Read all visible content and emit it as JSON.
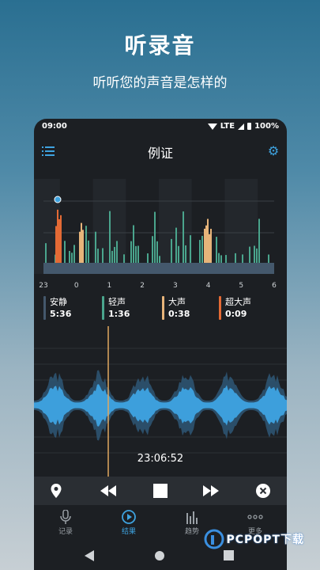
{
  "promo": {
    "title": "听录音",
    "subtitle": "听听您的声音是怎样的"
  },
  "status_bar": {
    "time": "09:00",
    "network": "LTE",
    "battery": "100%"
  },
  "app_bar": {
    "title": "例证",
    "menu_icon": "menu-icon",
    "settings_icon": "gear-icon"
  },
  "chart_data": {
    "type": "bar",
    "x_tick_labels": [
      "23",
      "0",
      "1",
      "2",
      "3",
      "4",
      "5",
      "6"
    ],
    "categories": [
      "安静",
      "轻声",
      "大声",
      "超大声"
    ],
    "colors": {
      "安静": "#44586c",
      "轻声": "#4aa58d",
      "大声": "#e7b47a",
      "超大声": "#e46a35"
    },
    "marker_hour": 23.5
  },
  "legend": [
    {
      "name": "安静",
      "value": "5:36",
      "color": "#44586c"
    },
    {
      "name": "轻声",
      "value": "1:36",
      "color": "#4aa58d"
    },
    {
      "name": "大声",
      "value": "0:38",
      "color": "#e7b47a"
    },
    {
      "name": "超大声",
      "value": "0:09",
      "color": "#e46a35"
    }
  ],
  "player": {
    "timestamp": "23:06:52",
    "wave_color": "#3d9fdc"
  },
  "transport": {
    "location_icon": "location-pin-icon",
    "rewind_icon": "rewind-icon",
    "stop_icon": "stop-icon",
    "forward_icon": "fast-forward-icon",
    "close_icon": "close-circle-icon"
  },
  "bottom_nav": [
    {
      "label": "记录",
      "icon": "microphone-icon",
      "active": false
    },
    {
      "label": "结果",
      "icon": "play-circle-icon",
      "active": true
    },
    {
      "label": "趋势",
      "icon": "bar-chart-icon",
      "active": false
    },
    {
      "label": "更多",
      "icon": "more-dots-icon",
      "active": false
    }
  ],
  "watermark": {
    "text": "PCPOPT下载"
  }
}
